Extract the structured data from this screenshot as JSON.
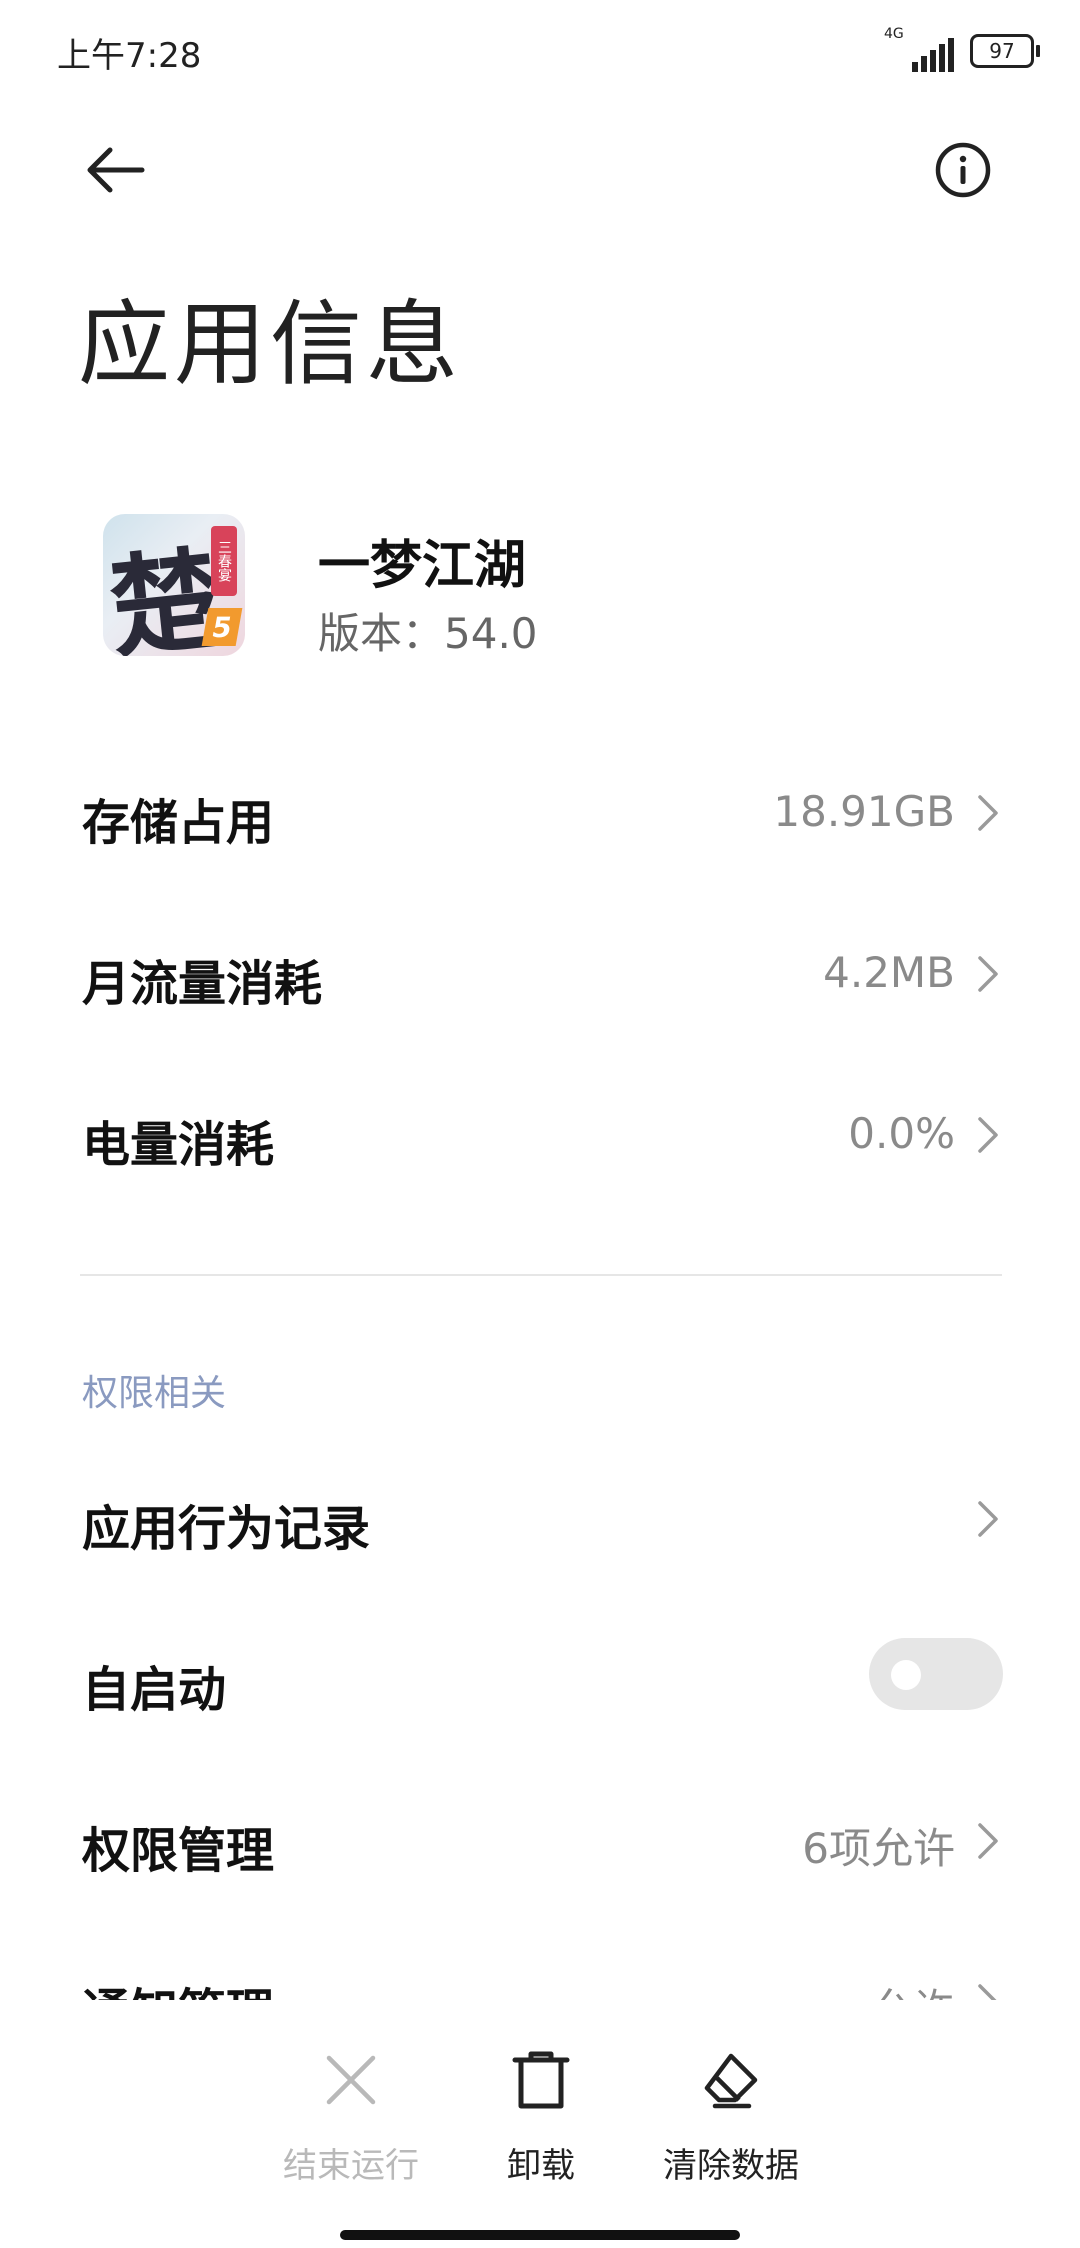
{
  "status_bar": {
    "time": "上午7:28",
    "network": "4G",
    "battery": "97"
  },
  "header": {
    "title": "应用信息"
  },
  "app": {
    "name": "一梦江湖",
    "version": "版本：54.0",
    "icon_glyph": "楚",
    "icon_stamp": "三春宴",
    "icon_number": "5"
  },
  "usage_rows": [
    {
      "label": "存储占用",
      "value": "18.91GB"
    },
    {
      "label": "月流量消耗",
      "value": "4.2MB"
    },
    {
      "label": "电量消耗",
      "value": "0.0%"
    }
  ],
  "permissions": {
    "section_title": "权限相关",
    "rows": [
      {
        "label": "应用行为记录",
        "value": ""
      },
      {
        "label": "自启动",
        "toggle": false
      },
      {
        "label": "权限管理",
        "value": "6项允许"
      },
      {
        "label": "通知管理",
        "value": "允许"
      }
    ]
  },
  "bottom_actions": [
    {
      "label": "结束运行",
      "icon": "close-icon",
      "enabled": false
    },
    {
      "label": "卸载",
      "icon": "trash-icon",
      "enabled": true
    },
    {
      "label": "清除数据",
      "icon": "eraser-icon",
      "enabled": true
    }
  ],
  "colors": {
    "section_title": "#8a9ac0",
    "value_text": "#8a8a8a",
    "disabled": "#b9b9b9"
  }
}
